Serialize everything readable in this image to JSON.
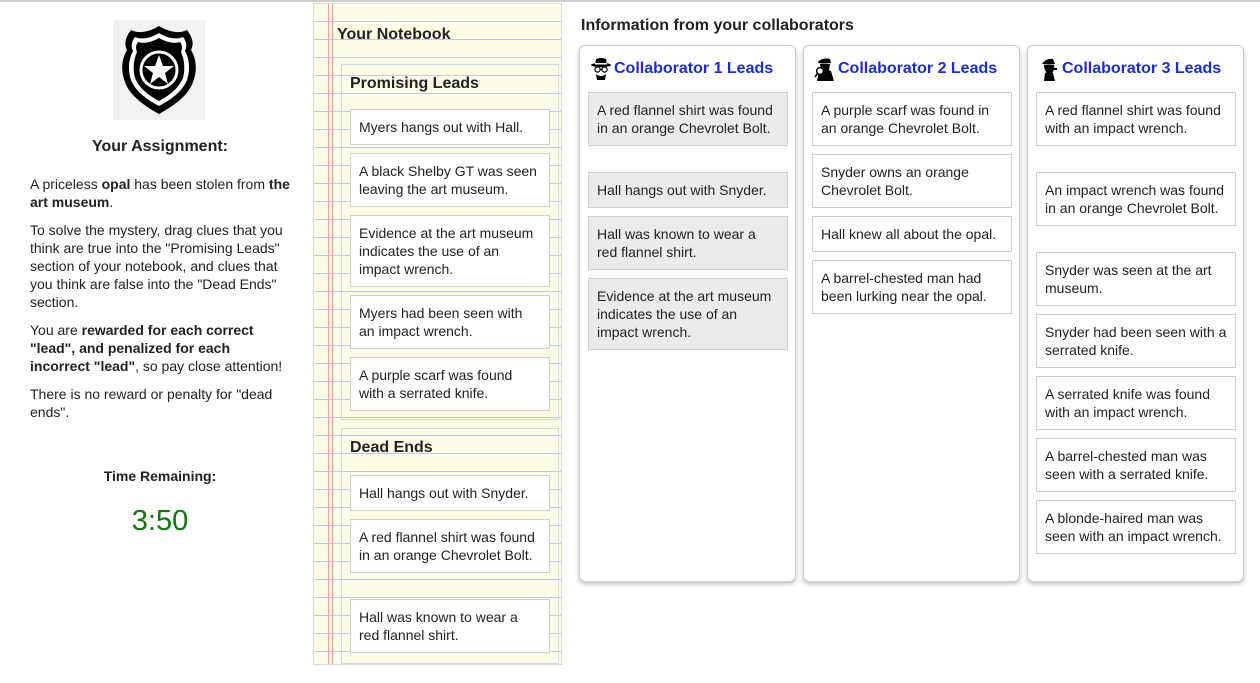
{
  "assignment": {
    "title": "Your Assignment:",
    "p1_pre": "A priceless ",
    "p1_item": "opal",
    "p1_mid": " has been stolen from ",
    "p1_place": "the art museum",
    "p1_end": ".",
    "p2": "To solve the mystery, drag clues that you think are true into the \"Promising Leads\" section of your notebook, and clues that you think are false into the \"Dead Ends\" section.",
    "p3_pre": "You are ",
    "p3_bold": "rewarded for each correct \"lead\", and penalized for each incorrect \"lead\"",
    "p3_end": ", so pay close attention!",
    "p4": "There is no reward or penalty for \"dead ends\".",
    "time_label": "Time Remaining:",
    "time_value": "3:50",
    "time_color": "#0a7a0a"
  },
  "notebook": {
    "title": "Your Notebook",
    "promising_title": "Promising Leads",
    "promising": [
      "Myers hangs out with Hall.",
      "A black Shelby GT was seen leaving the art museum.",
      "Evidence at the art museum indicates the use of an impact wrench.",
      "Myers had been seen with an impact wrench.",
      "A purple scarf was found with a serrated knife."
    ],
    "dead_title": "Dead Ends",
    "dead": [
      "Hall hangs out with Snyder.",
      "A red flannel shirt was found in an orange Chevrolet Bolt.",
      "Hall was known to wear a red flannel shirt."
    ]
  },
  "collaborators": {
    "heading": "Information from your collaborators",
    "title_color": "#1a2be0",
    "columns": [
      {
        "title": "Collaborator 1 Leads",
        "icon": "detective-hat-icon",
        "cards": [
          "A red flannel shirt was found in an orange Chevrolet Bolt.",
          "Hall hangs out with Snyder.",
          "Hall was known to wear a red flannel shirt.",
          "Evidence at the art museum indicates the use of an impact wrench."
        ]
      },
      {
        "title": "Collaborator 2 Leads",
        "icon": "spy-magnifier-icon",
        "cards": [
          "A purple scarf was found in an orange Chevrolet Bolt.",
          "Snyder owns an orange Chevrolet Bolt.",
          "Hall knew all about the opal.",
          "A barrel-chested man had been lurking near the opal."
        ]
      },
      {
        "title": "Collaborator 3 Leads",
        "icon": "detective-silhouette-icon",
        "cards": [
          "A red flannel shirt was found with an impact wrench.",
          "An impact wrench was found in an orange Chevrolet Bolt.",
          "Snyder was seen at the art museum.",
          "Snyder had been seen with a serrated knife.",
          "A serrated knife was found with an impact wrench.",
          "A barrel-chested man was seen with a serrated knife.",
          "A blonde-haired man was seen with an impact wrench."
        ]
      }
    ]
  }
}
